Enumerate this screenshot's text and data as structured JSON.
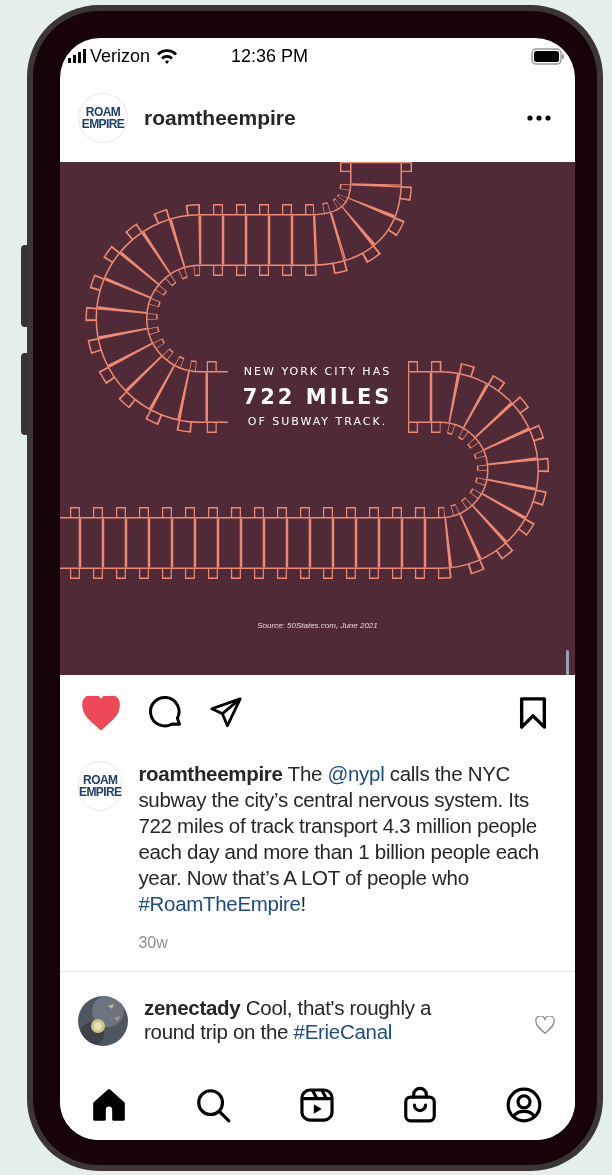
{
  "status_bar": {
    "carrier": "Verizon",
    "time": "12:36 PM"
  },
  "post": {
    "username": "roamtheempire",
    "avatar_lines": [
      "ROAM",
      "EMPIRE"
    ],
    "image": {
      "lines": [
        "NEW YORK CITY HAS",
        "722 MILES",
        "OF SUBWAY TRACK."
      ],
      "source": "Source: 50States.com, June 2021"
    },
    "liked": true,
    "saved": false,
    "caption_avatar_lines": [
      "ROAM",
      "EMPIRE"
    ],
    "caption": [
      {
        "kind": "user",
        "text": "roamtheempire"
      },
      {
        "kind": "text",
        "text": " The "
      },
      {
        "kind": "mention",
        "text": "@nypl"
      },
      {
        "kind": "text",
        "text": " calls the NYC subway the city’s central nervous system. Its 722 miles of track transport 4.3 million people each day and more than 1 billion people each year. Now that’s A LOT of people who "
      },
      {
        "kind": "hashtag",
        "text": "#RoamTheEmpire"
      },
      {
        "kind": "text",
        "text": "!"
      }
    ],
    "age": "30w"
  },
  "comment": {
    "liked": false,
    "parts": [
      {
        "kind": "user",
        "text": "zenectady"
      },
      {
        "kind": "text",
        "text": " Cool, that's roughly a round trip on the "
      },
      {
        "kind": "hashtag",
        "text": "#ErieCanal"
      }
    ]
  },
  "nav": [
    {
      "selected": true
    },
    {
      "selected": false
    },
    {
      "selected": false
    },
    {
      "selected": false
    },
    {
      "selected": false
    }
  ]
}
